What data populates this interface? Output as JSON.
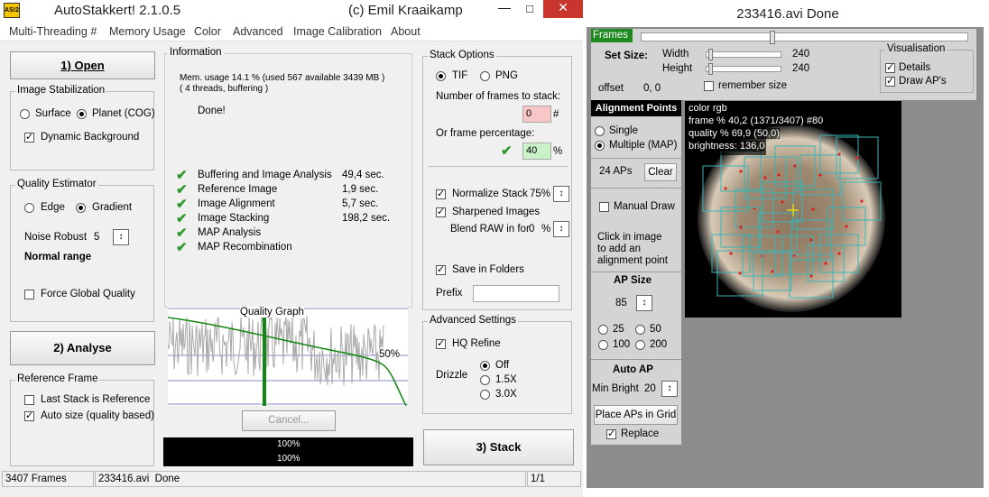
{
  "left_window": {
    "title": "AutoStakkert! 2.1.0.5",
    "author": "(c) Emil Kraaikamp",
    "logo": "AS!2"
  },
  "menu": [
    "Multi-Threading #",
    "Memory Usage",
    "Color",
    "Advanced",
    "Image Calibration",
    "About"
  ],
  "open_button": "1) Open",
  "stab": {
    "title": "Image Stabilization",
    "surface": "Surface",
    "planet": "Planet (COG)",
    "dynbg": "Dynamic Background"
  },
  "quality": {
    "title": "Quality Estimator",
    "edge": "Edge",
    "gradient": "Gradient",
    "noise_label": "Noise Robust",
    "noise_value": "5",
    "range": "Normal range",
    "force": "Force Global Quality"
  },
  "analyse_button": "2) Analyse",
  "ref": {
    "title": "Reference Frame",
    "last": "Last Stack is Reference",
    "auto": "Auto size (quality based)"
  },
  "info": {
    "title": "Information",
    "mem1": "Mem. usage 14.1 %  (used 567 available 3439 MB )",
    "mem2": "( 4 threads, buffering )",
    "done": "Done!",
    "steps": [
      {
        "label": "Buffering and Image Analysis",
        "time": "49,4 sec."
      },
      {
        "label": "Reference Image",
        "time": "1,9 sec."
      },
      {
        "label": "Image Alignment",
        "time": "5,7 sec."
      },
      {
        "label": "Image Stacking",
        "time": "198,2 sec."
      },
      {
        "label": "MAP Analysis",
        "time": ""
      },
      {
        "label": "MAP Recombination",
        "time": ""
      }
    ]
  },
  "graph": {
    "title": "Quality Graph",
    "pct": "50%"
  },
  "cancel_button": "Cancel...",
  "progress": {
    "p1": "100%",
    "p2": "100%"
  },
  "stack": {
    "title": "Stack Options",
    "tif": "TIF",
    "png": "PNG",
    "frames_label": "Number of frames to stack:",
    "frames_value": "0",
    "frames_unit": "#",
    "pct_label": "Or frame percentage:",
    "pct_value": "40",
    "pct_unit": "%",
    "normalize": "Normalize Stack",
    "normalize_val": "75%",
    "sharpened": "Sharpened Images",
    "blend": "Blend RAW in for",
    "blend_val": "0",
    "blend_unit": "%",
    "save": "Save in Folders",
    "prefix": "Prefix"
  },
  "adv": {
    "title": "Advanced Settings",
    "hq": "HQ Refine",
    "drizzle": "Drizzle",
    "off": "Off",
    "d15": "1.5X",
    "d30": "3.0X"
  },
  "stack_button": "3) Stack",
  "status": {
    "frames": "3407 Frames",
    "file": "233416.avi",
    "state": "Done",
    "page": "1/1"
  },
  "right_window": {
    "title": "233416.avi   Done"
  },
  "frames_label": "Frames",
  "setsize": {
    "label": "Set Size:",
    "width_label": "Width",
    "width_val": "240",
    "height_label": "Height",
    "height_val": "240",
    "offset_label": "offset",
    "offset_val": "0, 0",
    "remember": "remember size"
  },
  "vis": {
    "title": "Visualisation",
    "details": "Details",
    "draw": "Draw AP's"
  },
  "ap": {
    "title": "Alignment Points",
    "single": "Single",
    "multiple": "Multiple (MAP)",
    "count": "24 APs",
    "clear": "Clear",
    "manual": "Manual Draw",
    "hint1": "Click in image",
    "hint2": "to add an",
    "hint3": "alignment point",
    "size_title": "AP Size",
    "size_val": "85",
    "s25": "25",
    "s50": "50",
    "s100": "100",
    "s200": "200",
    "auto_title": "Auto AP",
    "minbright": "Min Bright",
    "minbright_val": "20",
    "place": "Place APs in Grid",
    "replace": "Replace"
  },
  "overlay": {
    "l1": "color rgb",
    "l2": "frame % 40,2 (1371/3407) #80",
    "l3": "quality % 69,9  (50,0)",
    "l4": "brightness: 136,0"
  },
  "colors": {
    "accent_green": "#0f7a1f",
    "frames_bar": "#1f8a1f",
    "ap_box": "#3ab5b5",
    "ap_dot": "#e02020"
  }
}
